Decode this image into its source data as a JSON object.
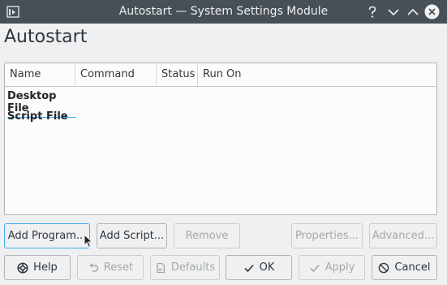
{
  "window": {
    "title": "Autostart — System Settings Module",
    "controls": [
      "question-icon",
      "minimize-icon",
      "maximize-icon",
      "close-icon"
    ]
  },
  "page": {
    "title": "Autostart"
  },
  "list": {
    "columns": [
      "Name",
      "Command",
      "Status",
      "Run On"
    ],
    "items": [
      "Desktop File",
      "Script File"
    ]
  },
  "actions": {
    "add_program": "Add Program...",
    "add_script": "Add Script...",
    "remove": "Remove",
    "properties": "Properties...",
    "advanced": "Advanced..."
  },
  "dialog": {
    "help": "Help",
    "reset": "Reset",
    "defaults": "Defaults",
    "ok": "OK",
    "apply": "Apply",
    "cancel": "Cancel"
  },
  "colors": {
    "titlebar": "#475057",
    "window_bg": "#eff0f1",
    "accent": "#3daee9",
    "close_circle": "#eff0f1"
  }
}
